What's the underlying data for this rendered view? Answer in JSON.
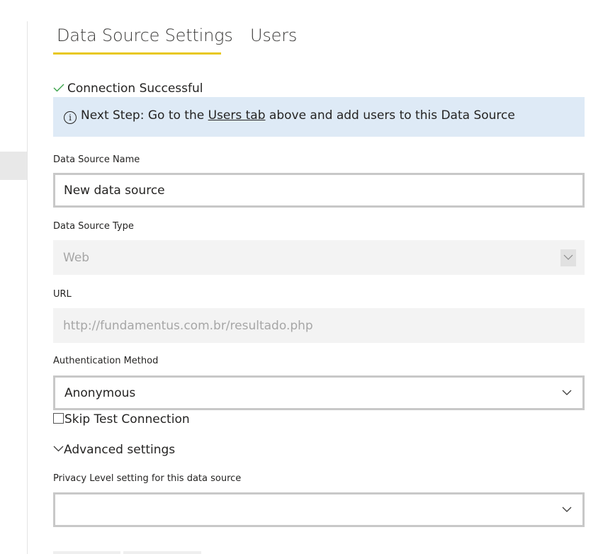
{
  "tabs": [
    {
      "label": "Data Source Settings",
      "active": true
    },
    {
      "label": "Users",
      "active": false
    }
  ],
  "accent_color": "#e8c81d",
  "status": {
    "icon": "check-icon",
    "text": "Connection Successful",
    "color": "#3aa34a"
  },
  "info_banner": {
    "icon": "info-icon",
    "prefix": "Next Step: Go to the ",
    "link_text": "Users tab",
    "suffix": " above and add users to this Data Source",
    "background": "#deeaf6"
  },
  "form": {
    "name": {
      "label": "Data Source Name",
      "value": "New data source"
    },
    "type": {
      "label": "Data Source Type",
      "value": "Web"
    },
    "url": {
      "label": "URL",
      "value": "http://fundamentus.com.br/resultado.php"
    },
    "auth": {
      "label": "Authentication Method",
      "value": "Anonymous"
    },
    "skip_test": {
      "label": "Skip Test Connection",
      "checked": false
    },
    "advanced": {
      "label": "Advanced settings",
      "expanded": true
    },
    "privacy": {
      "label": "Privacy Level setting for this data source",
      "value": ""
    }
  }
}
